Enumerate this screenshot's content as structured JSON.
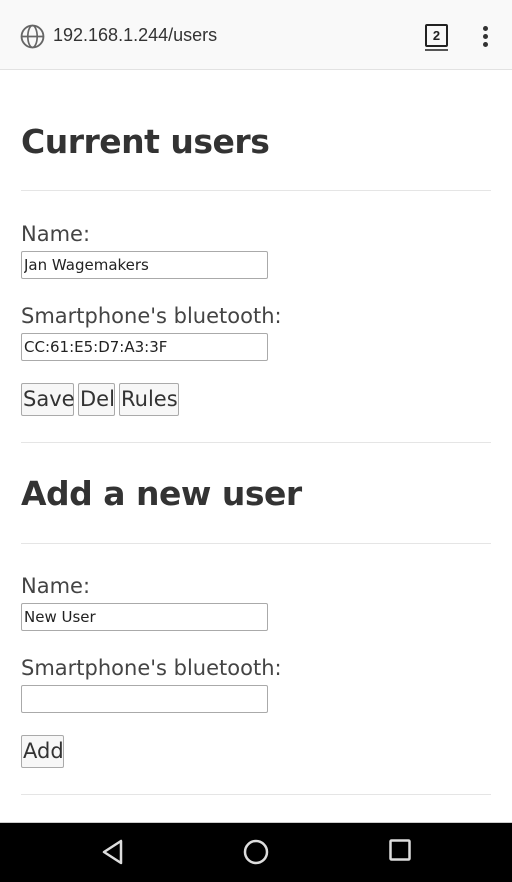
{
  "browser": {
    "url": "192.168.1.244/users",
    "tab_count": "2",
    "icons": {
      "site": "globe-icon",
      "tabs": "tab-switcher-icon",
      "menu": "overflow-menu-icon"
    }
  },
  "current_users": {
    "title": "Current users",
    "name_label": "Name:",
    "name_value": "Jan Wagemakers",
    "bt_label": "Smartphone's bluetooth:",
    "bt_value": "CC:61:E5:D7:A3:3F",
    "buttons": {
      "save": "Save",
      "del": "Del",
      "rules": "Rules"
    }
  },
  "add_user": {
    "title": "Add a new user",
    "name_label": "Name:",
    "name_value": "New User",
    "bt_label": "Smartphone's bluetooth:",
    "bt_value": "",
    "add_button": "Add"
  },
  "navbar": {
    "icons": [
      "back-icon",
      "home-icon",
      "recents-icon"
    ]
  }
}
